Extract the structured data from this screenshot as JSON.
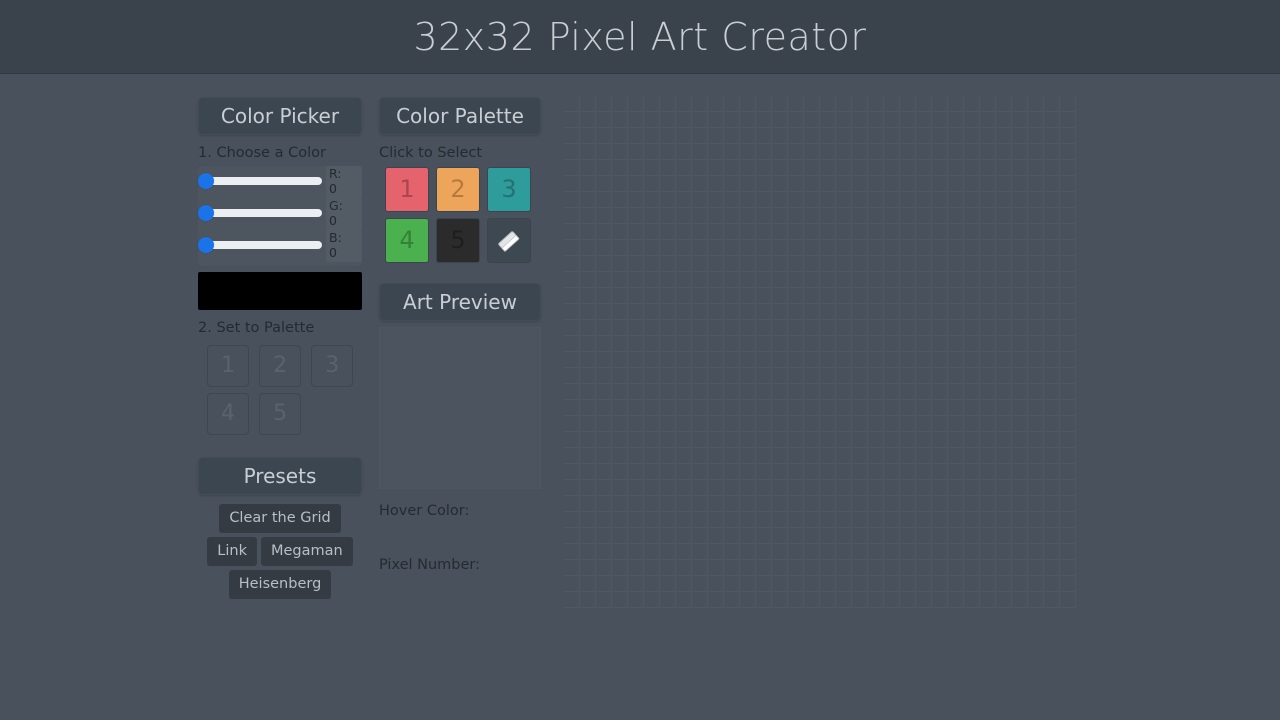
{
  "app": {
    "title": "32x32 Pixel Art Creator",
    "background_color": "#49525c",
    "topbar_color": "#3a424c"
  },
  "color_picker": {
    "header": "Color Picker",
    "step1_label": "1. Choose a Color",
    "step2_label": "2. Set to Palette",
    "sliders": [
      {
        "channel": "R",
        "label": "R:",
        "value": "0",
        "value_num": 0,
        "thumb_color": "#1a73e8"
      },
      {
        "channel": "G",
        "label": "G:",
        "value": "0",
        "value_num": 0,
        "thumb_color": "#1a73e8"
      },
      {
        "channel": "B",
        "label": "B:",
        "value": "0",
        "value_num": 0,
        "thumb_color": "#1a73e8"
      }
    ],
    "preview_color": "#000000",
    "set_buttons": [
      {
        "label": "1"
      },
      {
        "label": "2"
      },
      {
        "label": "3"
      },
      {
        "label": "4"
      },
      {
        "label": "5"
      }
    ]
  },
  "presets": {
    "header": "Presets",
    "buttons": [
      {
        "label": "Clear the Grid"
      },
      {
        "label": "Link"
      },
      {
        "label": "Megaman"
      },
      {
        "label": "Heisenberg"
      }
    ]
  },
  "palette": {
    "header": "Color Palette",
    "instruction": "Click to Select",
    "swatches": [
      {
        "label": "1",
        "color": "#e4636c"
      },
      {
        "label": "2",
        "color": "#eda45b"
      },
      {
        "label": "3",
        "color": "#2e9c9a"
      },
      {
        "label": "4",
        "color": "#4bb14f"
      },
      {
        "label": "5",
        "color": "#2b2b2b"
      }
    ],
    "eraser": {
      "icon": "eraser-icon",
      "label": ""
    }
  },
  "preview": {
    "header": "Art Preview",
    "hover_color_label": "Hover Color:",
    "hover_color_value": "",
    "pixel_number_label": "Pixel Number:",
    "pixel_number_value": ""
  },
  "grid": {
    "columns": 32,
    "rows": 32,
    "cell_size_px": 16,
    "gridline_color": "rgba(255,255,255,0.035)",
    "filled_pixels": []
  }
}
